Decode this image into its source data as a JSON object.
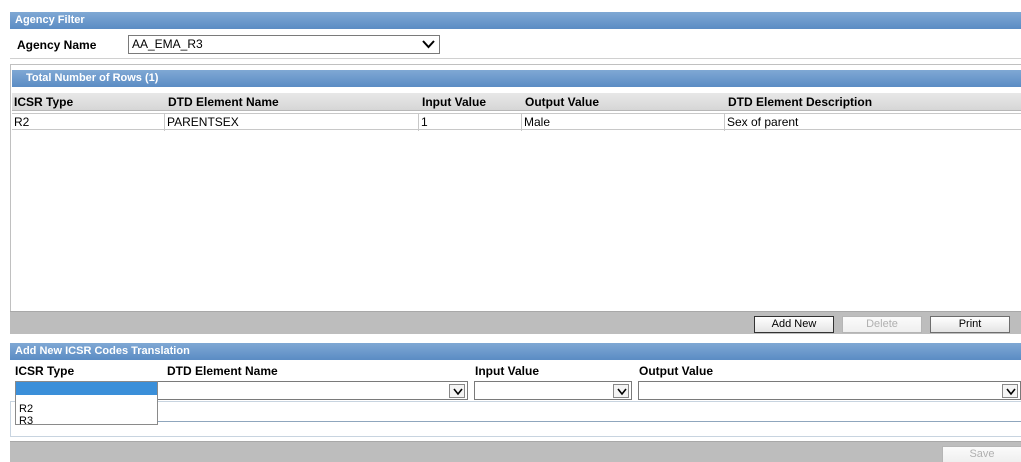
{
  "agency_filter": {
    "header": "Agency Filter",
    "agency_name_label": "Agency Name",
    "agency_name_value": "AA_EMA_R3"
  },
  "grid": {
    "header": "Total Number of Rows (1)",
    "columns": [
      "ICSR Type",
      "DTD Element Name",
      "Input Value",
      "Output Value",
      "DTD Element Description"
    ],
    "rows": [
      [
        "R2",
        "PARENTSEX",
        "1",
        "Male",
        "Sex of parent"
      ]
    ],
    "buttons": {
      "add_new": "Add New",
      "delete": "Delete",
      "print": "Print"
    }
  },
  "add_new": {
    "header": "Add New ICSR Codes Translation",
    "labels": {
      "icsr_type": "ICSR Type",
      "dtd_element_name": "DTD Element Name",
      "input_value": "Input Value",
      "output_value": "Output Value"
    },
    "icsr_type_options": [
      "",
      "R2",
      "R3"
    ],
    "save_label": "Save"
  },
  "colors": {
    "header_blue": "#6a98cc",
    "toolbar_gray": "#bdbdbd",
    "selection_blue": "#3b8fd9"
  }
}
